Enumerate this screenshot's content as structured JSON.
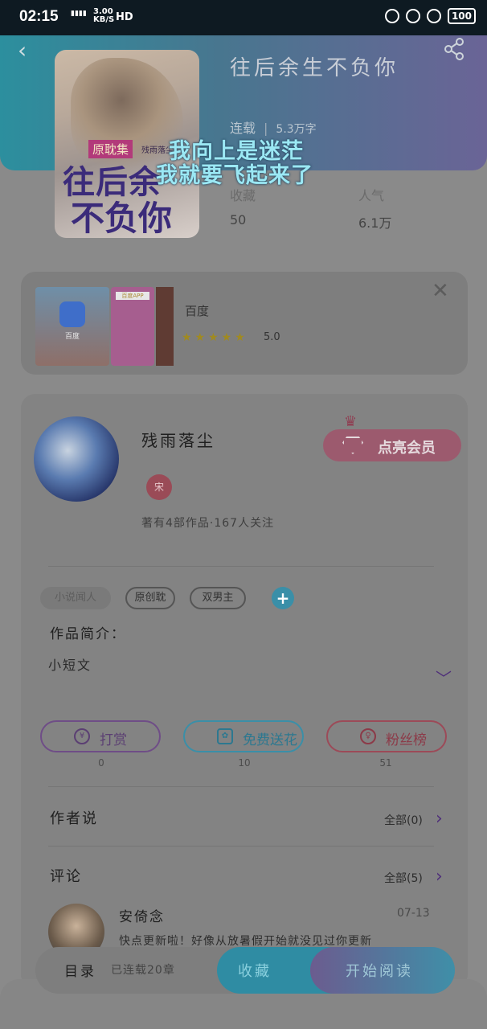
{
  "status": {
    "time": "02:15",
    "network": "4G",
    "speed": "3.00",
    "speed_unit": "KB/S",
    "hd": "HD",
    "battery": "100"
  },
  "book": {
    "title": "往后余生不负你",
    "status": "连载",
    "words": "5.3万字",
    "cover": {
      "badge": "原耽集",
      "author_small": "残雨落尘",
      "line1": "往后余",
      "line2": "不负你"
    },
    "stats": [
      {
        "label": "收藏",
        "value": "50"
      },
      {
        "label": "人气",
        "value": "6.1万"
      }
    ]
  },
  "overlay": {
    "line1": "我向上是迷茫",
    "line2": "我就要飞起来了"
  },
  "ad": {
    "name": "百度",
    "stars": "★★★★★",
    "rating": "5.0",
    "img_caption": "百度",
    "img2_label": "百度APP"
  },
  "author": {
    "name": "残雨落尘",
    "badge": "宋",
    "stats": "著有4部作品·167人关注",
    "vip_label": "点亮会员"
  },
  "tags": [
    "小说闻人",
    "原创耽",
    "双男主"
  ],
  "intro": {
    "label": "作品简介：",
    "text": "小短文"
  },
  "actions": [
    {
      "label": "打赏",
      "icon": "¥",
      "count": "0"
    },
    {
      "label": "免费送花",
      "icon": "✿",
      "count": "10"
    },
    {
      "label": "粉丝榜",
      "icon": "♀",
      "count": "51"
    }
  ],
  "author_says": {
    "title": "作者说",
    "more": "全部(0)"
  },
  "comments": {
    "title": "评论",
    "more": "全部(5)",
    "items": [
      {
        "name": "安倚念",
        "date": "07-13",
        "text": "快点更新啦！好像从放暑假开始就没见过你更新"
      }
    ]
  },
  "bottom": {
    "toc": "目录",
    "toc_sub": "已连载20章",
    "collect": "收藏",
    "read": "开始阅读"
  },
  "colors": {
    "accent_teal": "#2f8ca3",
    "accent_purple": "#6b5c8f",
    "accent_red": "#9c4a58"
  }
}
